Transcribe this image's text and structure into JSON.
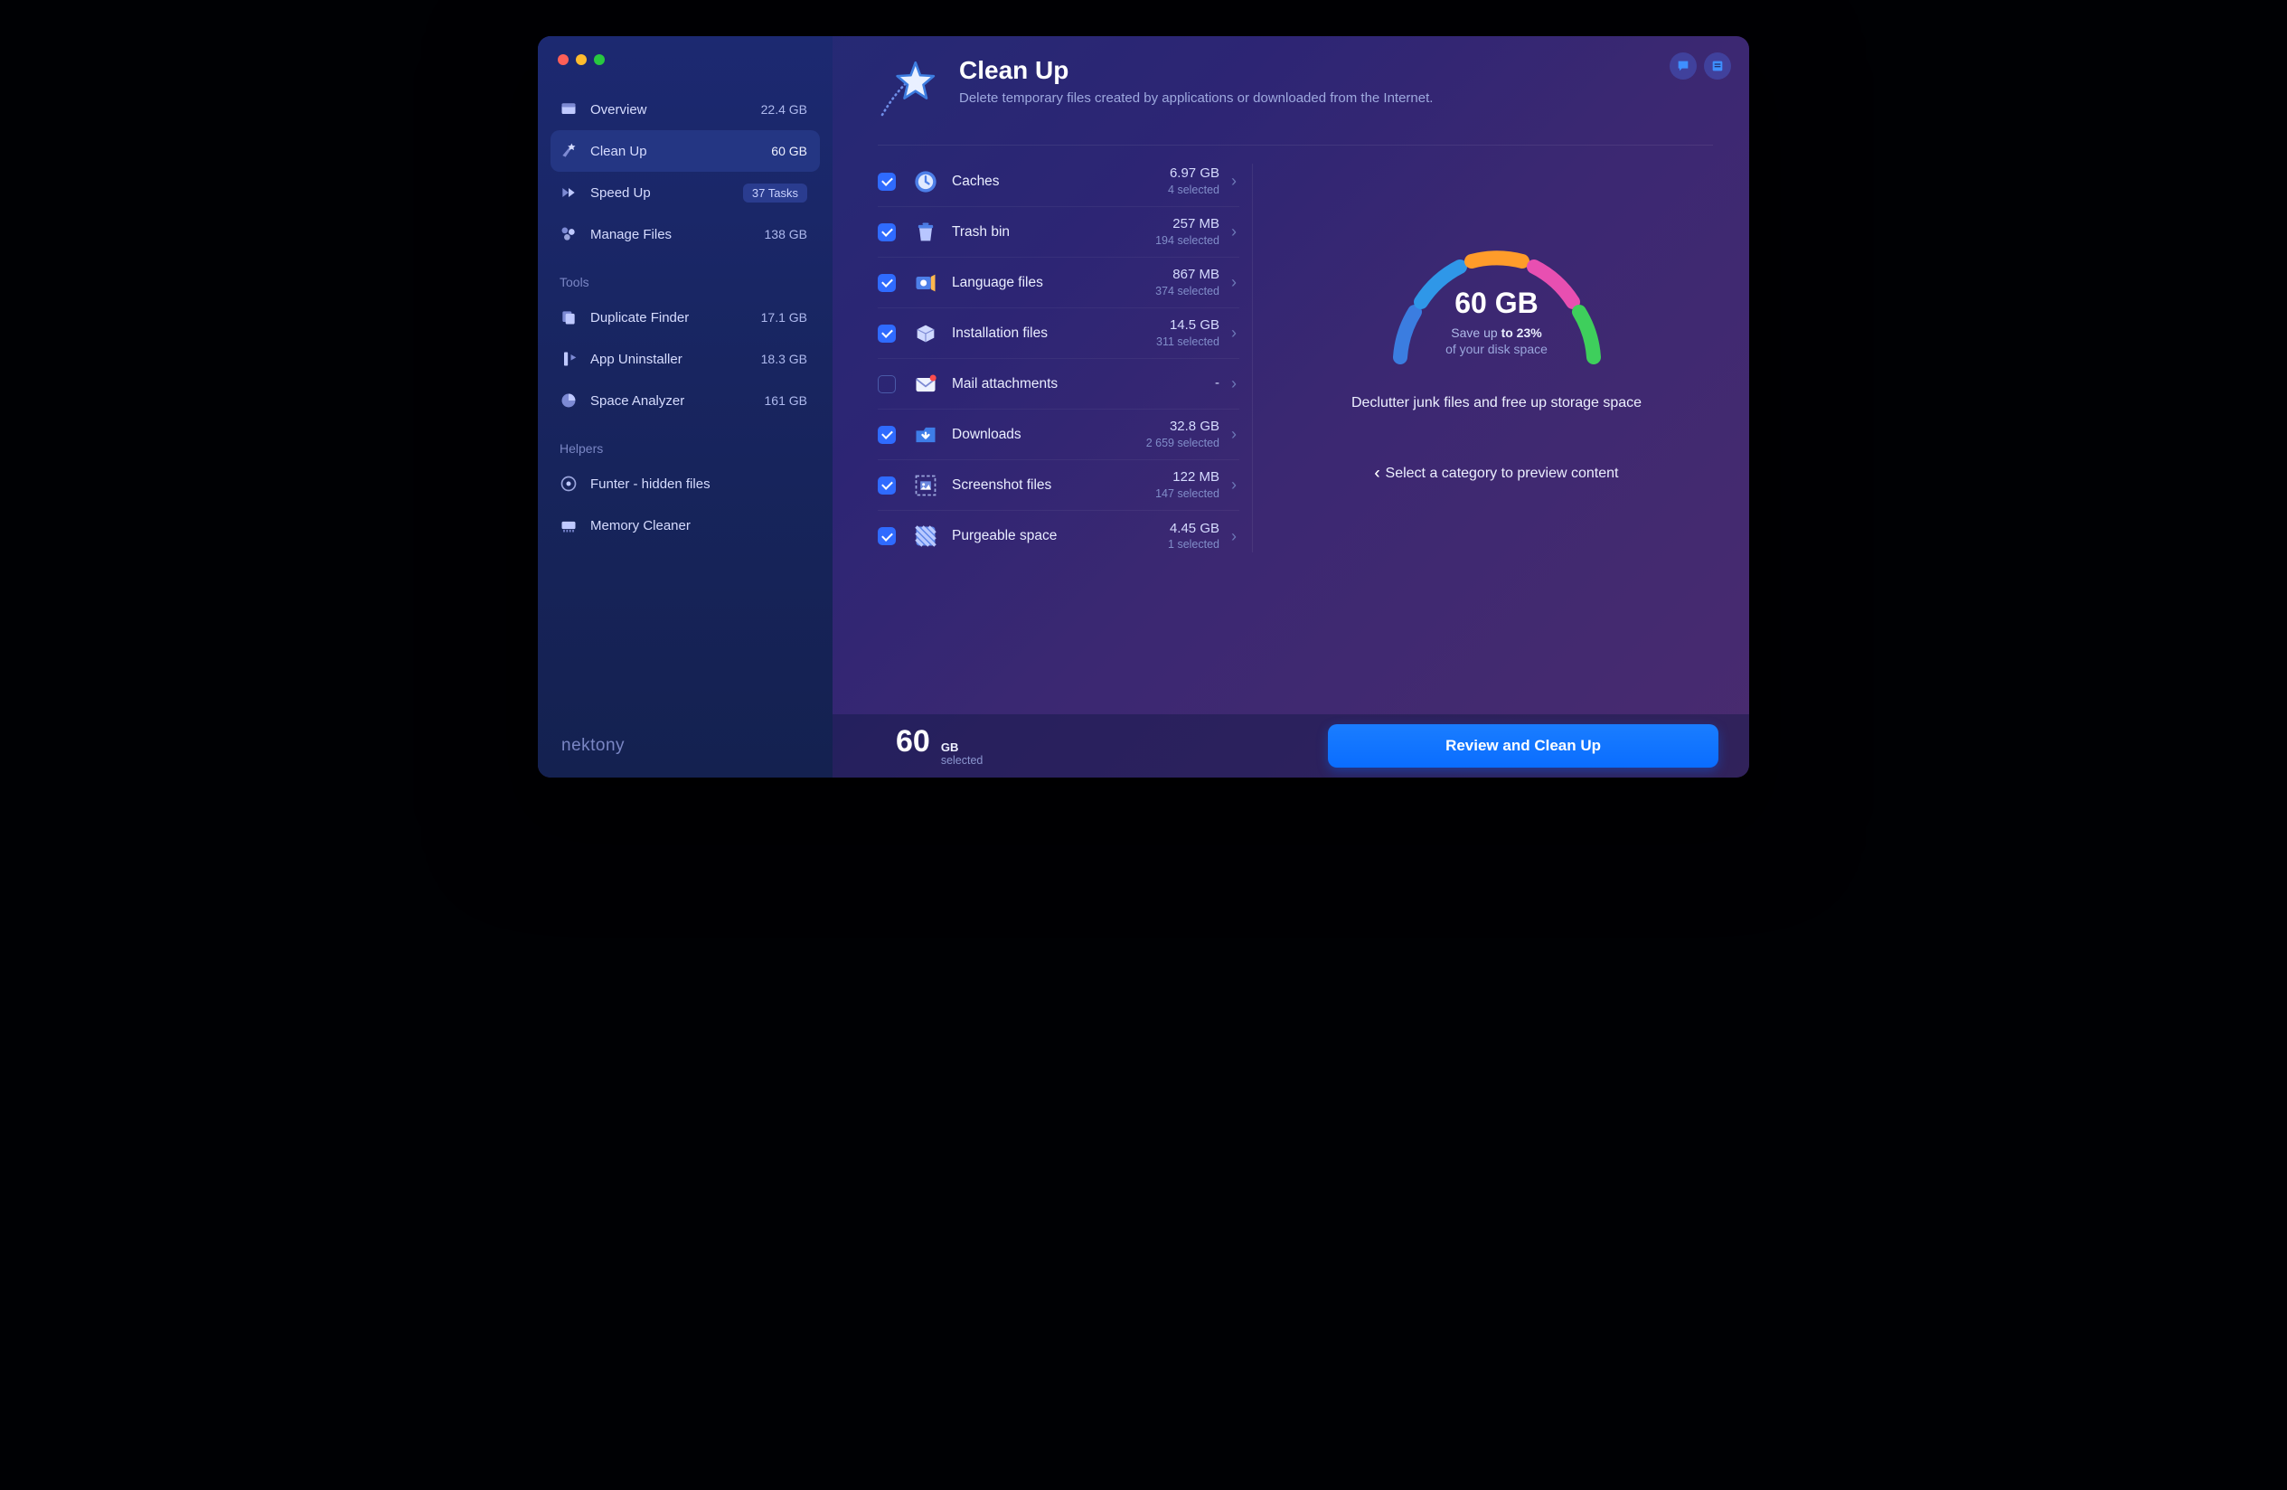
{
  "brand": "nektony",
  "sidebar": {
    "main": [
      {
        "label": "Overview",
        "meta": "22.4 GB"
      },
      {
        "label": "Clean Up",
        "meta": "60 GB"
      },
      {
        "label": "Speed Up",
        "meta": "37 Tasks"
      },
      {
        "label": "Manage Files",
        "meta": "138 GB"
      }
    ],
    "tools_label": "Tools",
    "tools": [
      {
        "label": "Duplicate Finder",
        "meta": "17.1 GB"
      },
      {
        "label": "App Uninstaller",
        "meta": "18.3 GB"
      },
      {
        "label": "Space Analyzer",
        "meta": "161 GB"
      }
    ],
    "helpers_label": "Helpers",
    "helpers": [
      {
        "label": "Funter - hidden files"
      },
      {
        "label": "Memory Cleaner"
      }
    ]
  },
  "hero": {
    "title": "Clean Up",
    "subtitle": "Delete temporary files created by applications or downloaded from the Internet."
  },
  "categories": [
    {
      "name": "Caches",
      "size": "6.97 GB",
      "selected": "4 selected",
      "checked": true
    },
    {
      "name": "Trash bin",
      "size": "257 MB",
      "selected": "194 selected",
      "checked": true
    },
    {
      "name": "Language files",
      "size": "867 MB",
      "selected": "374 selected",
      "checked": true
    },
    {
      "name": "Installation files",
      "size": "14.5 GB",
      "selected": "311 selected",
      "checked": true
    },
    {
      "name": "Mail attachments",
      "size": "-",
      "selected": "",
      "checked": false
    },
    {
      "name": "Downloads",
      "size": "32.8 GB",
      "selected": "2 659 selected",
      "checked": true
    },
    {
      "name": "Screenshot files",
      "size": "122 MB",
      "selected": "147 selected",
      "checked": true
    },
    {
      "name": "Purgeable space",
      "size": "4.45 GB",
      "selected": "1 selected",
      "checked": true
    }
  ],
  "summary": {
    "value": "60 GB",
    "save_prefix": "Save up ",
    "save_bold": "to 23%",
    "save_line2": "of your disk space",
    "declutter": "Declutter junk files and free up storage space",
    "hint": "Select a category to preview content"
  },
  "footer": {
    "num": "60",
    "unit": "GB",
    "selected": "selected",
    "cta": "Review and Clean Up"
  },
  "chart_data": {
    "type": "pie",
    "title": "Junk breakdown (semi-donut gauge)",
    "categories": [
      "Caches",
      "Trash bin",
      "Language files",
      "Installation files",
      "Downloads",
      "Screenshot files",
      "Purgeable space"
    ],
    "values": [
      6.97,
      0.257,
      0.867,
      14.5,
      32.8,
      0.122,
      4.45
    ],
    "total_label": "60 GB",
    "save_pct": 23,
    "colors": [
      "#3b7de0",
      "#2f97e8",
      "#ff9c2a",
      "#ff6f3d",
      "#e84fb1",
      "#b94fe8",
      "#3ecf5c"
    ]
  }
}
